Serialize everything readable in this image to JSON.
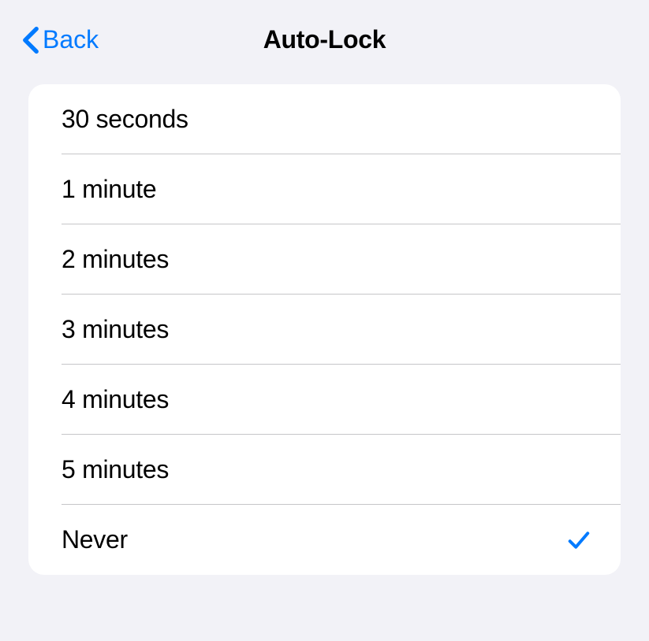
{
  "header": {
    "back_label": "Back",
    "title": "Auto-Lock"
  },
  "options": [
    {
      "label": "30 seconds",
      "selected": false
    },
    {
      "label": "1 minute",
      "selected": false
    },
    {
      "label": "2 minutes",
      "selected": false
    },
    {
      "label": "3 minutes",
      "selected": false
    },
    {
      "label": "4 minutes",
      "selected": false
    },
    {
      "label": "5 minutes",
      "selected": false
    },
    {
      "label": "Never",
      "selected": true
    }
  ],
  "colors": {
    "accent": "#007aff",
    "background": "#f2f2f7",
    "card": "#ffffff",
    "separator": "#c6c6c8"
  }
}
